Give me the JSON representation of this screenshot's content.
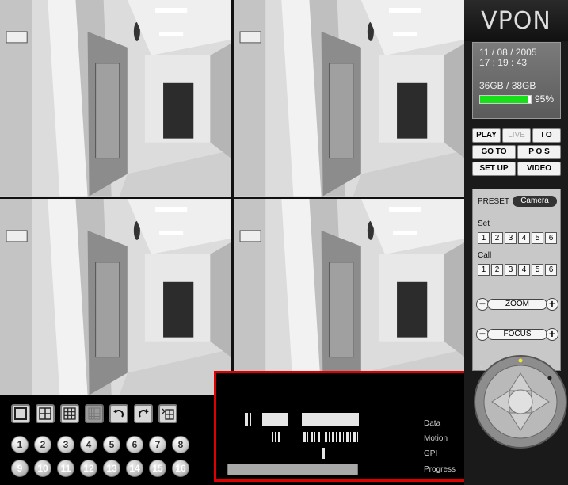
{
  "brand": {
    "logo": "VPON"
  },
  "status_panel": {
    "date": "11 / 08 / 2005",
    "time": "17 : 19 : 43",
    "storage": "36GB / 38GB",
    "storage_used": 0.95,
    "storage_pct": "95%",
    "meter_color": "#18e018"
  },
  "mode_buttons": {
    "row1": [
      "PLAY",
      "LIVE",
      "I O"
    ],
    "row2": [
      "GO TO",
      "P O S"
    ],
    "row3": [
      "SET UP",
      "VIDEO"
    ]
  },
  "ptz": {
    "preset_label": "PRESET",
    "camera_label": "Camera",
    "set_label": "Set",
    "call_label": "Call",
    "presets": [
      "1",
      "2",
      "3",
      "4",
      "5",
      "6"
    ],
    "zoom_label": "ZOOM",
    "focus_label": "FOCUS",
    "minus": "−",
    "plus": "+"
  },
  "channels_row1": [
    "1",
    "2",
    "3",
    "4",
    "5",
    "6",
    "7",
    "8"
  ],
  "channels_row2": [
    "9",
    "10",
    "11",
    "12",
    "13",
    "14",
    "15",
    "16"
  ],
  "indicators": {
    "data": "Data",
    "motion": "Motion",
    "gpi": "GPI",
    "progress": "Progress"
  },
  "highlight_color": "#e00000"
}
